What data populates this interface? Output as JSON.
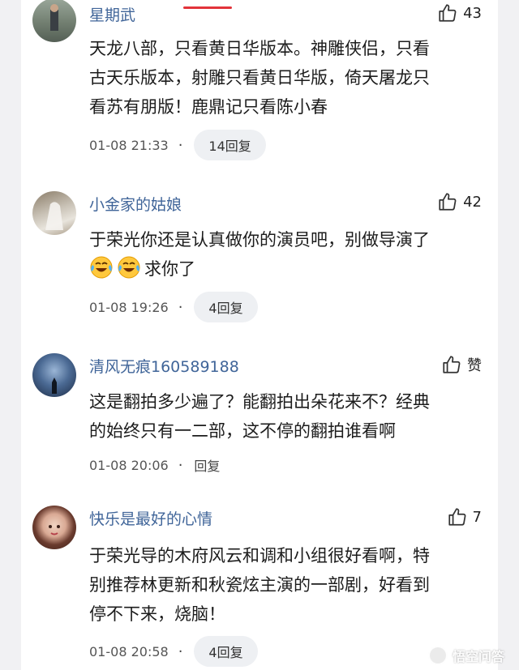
{
  "comments": [
    {
      "username": "星期武",
      "likes": "43",
      "lines": [
        "天龙八部，只看黄日华版本。神雕侠侣，只看",
        "古天乐版本，射雕只看黄日华版，倚天屠龙只",
        "看苏有朋版！鹿鼎记只看陈小春"
      ],
      "time": "01-08 21:33",
      "reply": "14回复"
    },
    {
      "username": "小金家的姑娘",
      "likes": "42",
      "lines": [
        "于荣光你还是认真做你的演员吧，别做导演了",
        "求你了"
      ],
      "emojis": [
        "crying-laughing-emoji",
        "crying-laughing-emoji"
      ],
      "time": "01-08 19:26",
      "reply": "4回复"
    },
    {
      "username": "清风无痕160589188",
      "likes": "赞",
      "lines": [
        "这是翻拍多少遍了？能翻拍出朵花来不？经典",
        "的始终只有一二部，这不停的翻拍谁看啊"
      ],
      "time": "01-08 20:06",
      "reply": "回复"
    },
    {
      "username": "快乐是最好的心情",
      "likes": "7",
      "lines": [
        "于荣光导的木府风云和调和小组很好看啊，特",
        "别推荐林更新和秋瓷炫主演的一部剧，好看到",
        "停不下来，烧脑！"
      ],
      "time": "01-08 20:58",
      "reply": "4回复"
    }
  ],
  "separator": "·",
  "watermark": "悟空问答",
  "colors": {
    "username": "#406599",
    "accent": "#e2333a",
    "background": "#f1f1f3"
  }
}
